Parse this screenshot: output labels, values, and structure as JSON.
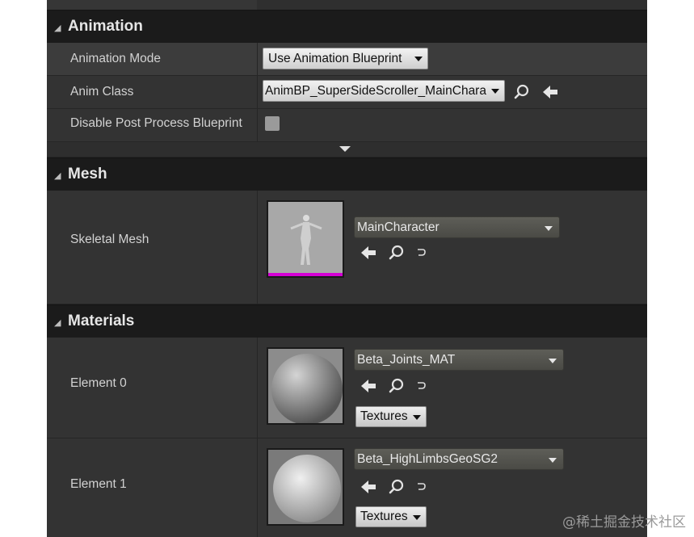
{
  "sections": {
    "animation": {
      "title": "Animation",
      "mode_label": "Animation Mode",
      "mode_value": "Use Animation Blueprint",
      "anim_class_label": "Anim Class",
      "anim_class_value": "AnimBP_SuperSideScroller_MainChara",
      "disable_pp_label": "Disable Post Process Blueprint"
    },
    "mesh": {
      "title": "Mesh",
      "skeletal_mesh_label": "Skeletal Mesh",
      "skeletal_mesh_value": "MainCharacter"
    },
    "materials": {
      "title": "Materials",
      "elements": [
        {
          "label": "Element 0",
          "value": "Beta_Joints_MAT",
          "textures_label": "Textures"
        },
        {
          "label": "Element 1",
          "value": "Beta_HighLimbsGeoSG2",
          "textures_label": "Textures"
        }
      ]
    }
  },
  "icons": {
    "collapse": "triangle-down-icon",
    "browse": "search-icon",
    "use_selected": "arrow-left-icon",
    "reset": "reset-arrow-icon"
  },
  "colors": {
    "panel_bg": "#262626",
    "row_bg": "#333333",
    "header_bg": "#1b1b1b",
    "mesh_thumb_bar": "#d400d4"
  },
  "watermark": "@稀土掘金技术社区"
}
